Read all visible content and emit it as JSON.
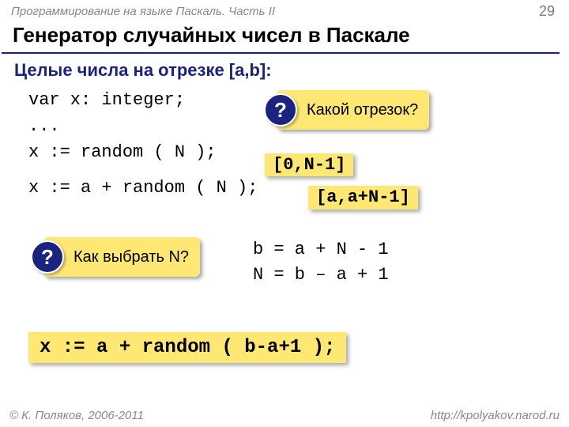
{
  "header": {
    "course": "Программирование на языке Паскаль. Часть II",
    "page": "29"
  },
  "title": "Генератор случайных чисел в Паскале",
  "subtitle": "Целые числа на отрезке [a,b]:",
  "code1": "var x: integer;\n...\nx := random ( N );",
  "code2": "x := a + random ( N );",
  "callout1": "Какой отрезок?",
  "callout2": "Как выбрать N?",
  "label1": "[0,N-1]",
  "label2": "[a,a+N-1]",
  "math": "b = a + N - 1\nN = b – a + 1",
  "final": "x := a + random ( b-a+1 );",
  "footer": {
    "left": "© К. Поляков, 2006-2011",
    "right": "http://kpolyakov.narod.ru"
  }
}
